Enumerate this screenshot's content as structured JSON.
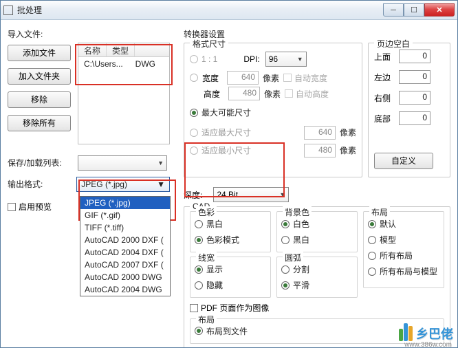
{
  "window": {
    "title": "批处理"
  },
  "left": {
    "import_label": "导入文件:",
    "buttons": {
      "add_file": "添加文件",
      "add_folder": "加入文件夹",
      "remove": "移除",
      "remove_all": "移除所有"
    },
    "filelist": {
      "headers": {
        "name": "名称",
        "type": "类型"
      },
      "row": {
        "name": "C:\\Users...",
        "type": "DWG"
      }
    },
    "save_load_label": "保存/加载列表:",
    "output_format_label": "输出格式:",
    "output_format_value": "JPEG (*.jpg)",
    "dropdown": [
      "JPEG (*.jpg)",
      "GIF (*.gif)",
      "TIFF (*.tiff)",
      "AutoCAD 2000 DXF (",
      "AutoCAD 2004 DXF (",
      "AutoCAD 2007 DXF (",
      "AutoCAD 2000 DWG",
      "AutoCAD 2004 DWG"
    ],
    "enable_preview": "启用预览"
  },
  "right": {
    "converter_settings": "转换器设置",
    "format_size": {
      "title": "格式尺寸",
      "one_to_one": "1 : 1",
      "dpi_label": "DPI:",
      "dpi_value": "96",
      "width_label": "宽度",
      "width_value": "640",
      "px1": "像素",
      "auto_width": "自动宽度",
      "height_label": "高度",
      "height_value": "480",
      "px2": "像素",
      "auto_height": "自动高度",
      "max_possible": "最大可能尺寸",
      "fit_max": "适应最大尺寸",
      "fit_max_val": "640",
      "px3": "像素",
      "fit_min": "适应最小尺寸",
      "fit_min_val": "480",
      "px4": "像素"
    },
    "margins": {
      "title": "页边空白",
      "top": "上面",
      "top_v": "0",
      "left": "左边",
      "left_v": "0",
      "right": "右侧",
      "right_v": "0",
      "bottom": "底部",
      "bottom_v": "0",
      "custom": "自定义"
    },
    "depth": {
      "label": "深度:",
      "value": "24 Bit"
    },
    "cad": {
      "title": "CAD",
      "color": {
        "title": "色彩",
        "black_white": "黑白",
        "color_mode": "色彩模式"
      },
      "bg": {
        "title": "背景色",
        "white": "白色",
        "black": "黑白"
      },
      "layout": {
        "title": "布局",
        "default": "默认",
        "model": "模型",
        "all": "所有布局",
        "all_model": "所有布局与模型"
      },
      "lw": {
        "title": "线宽",
        "show": "显示",
        "hide": "隐藏"
      },
      "arc": {
        "title": "圆弧",
        "seg": "分割",
        "smooth": "平滑"
      },
      "pdf_as_image": "PDF 页面作为图像",
      "layout2": "布局",
      "layout2_opt": "布局到文件"
    }
  },
  "watermark": {
    "text": "乡巴佬",
    "url": "www.386w.com"
  }
}
